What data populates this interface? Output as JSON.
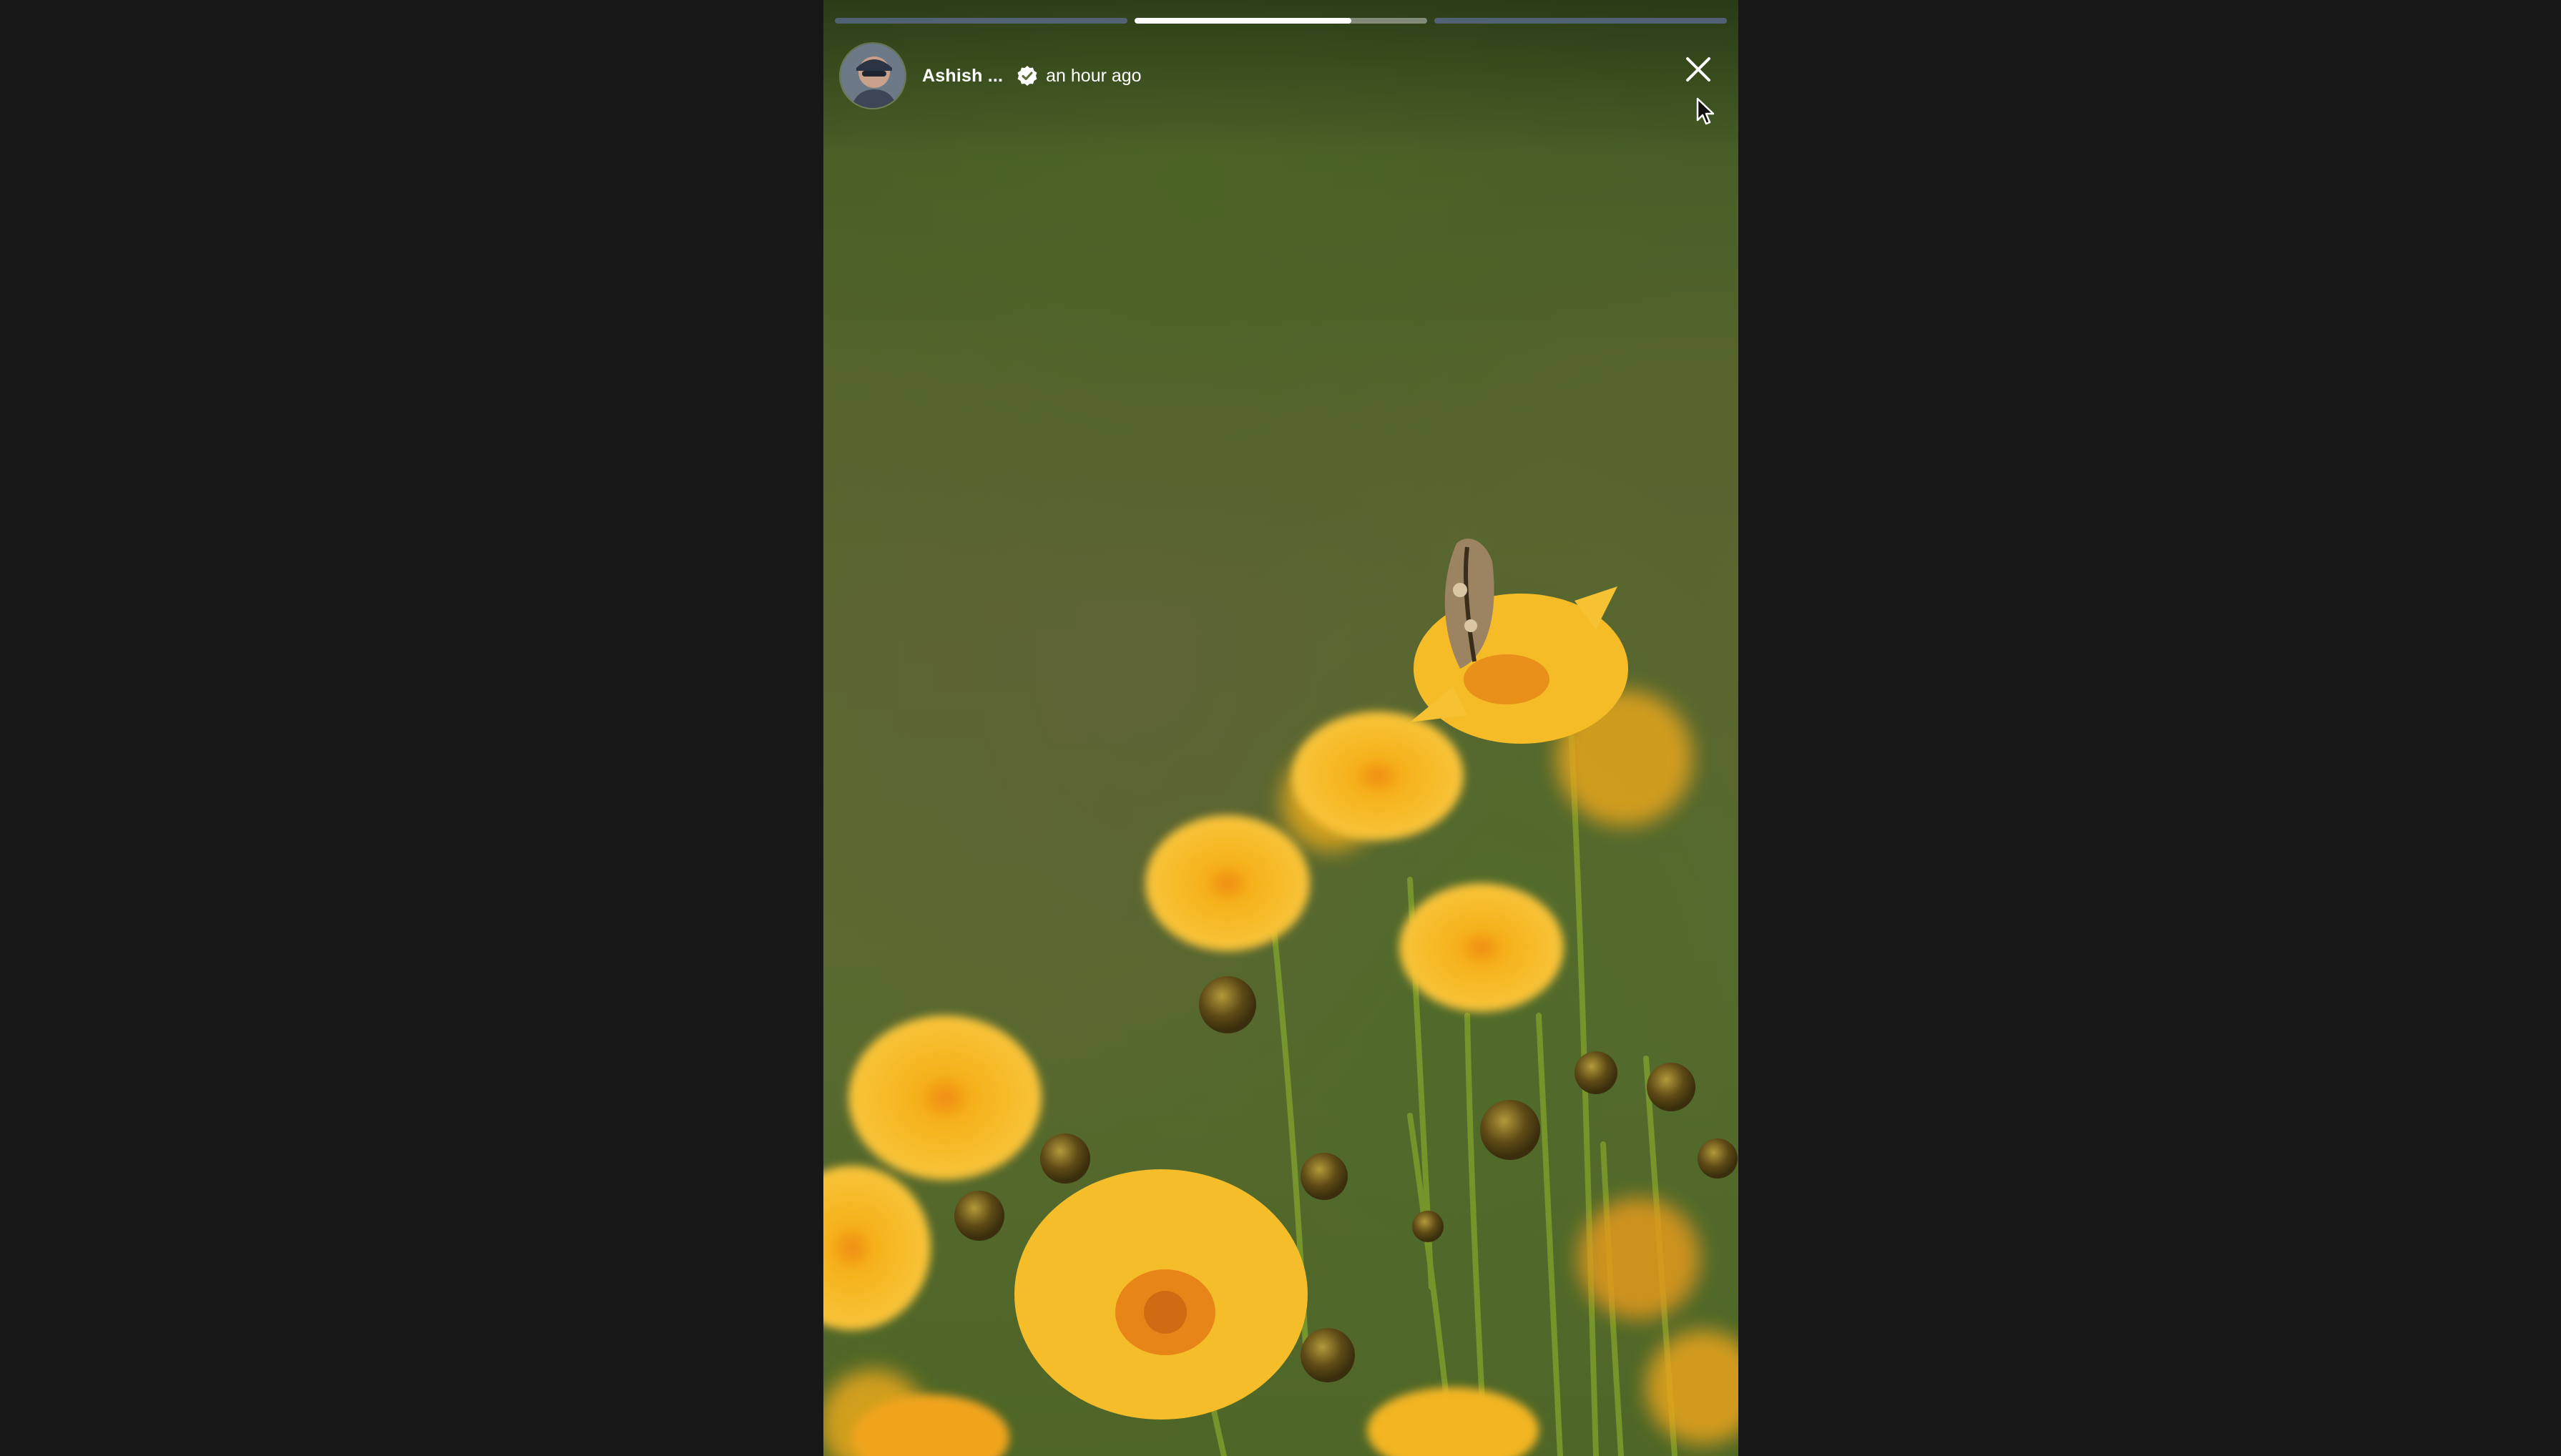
{
  "story": {
    "author": {
      "name": "Ashish ...",
      "verified": true,
      "avatar_icon": "avatar-photo"
    },
    "timestamp": "an hour ago",
    "progress": {
      "segment_count": 3,
      "current_index": 1,
      "current_fraction": 0.74
    },
    "close_icon": "close-icon",
    "media_description_icon": "story-photo"
  },
  "colors": {
    "page_background": "#171717",
    "progress_fill": "#ffffff",
    "progress_past": "#5f6e96",
    "progress_track": "#c8c8c8",
    "text": "#ffffff",
    "flower_yellow": "#f5b91f",
    "foliage_green": "#55642d"
  }
}
